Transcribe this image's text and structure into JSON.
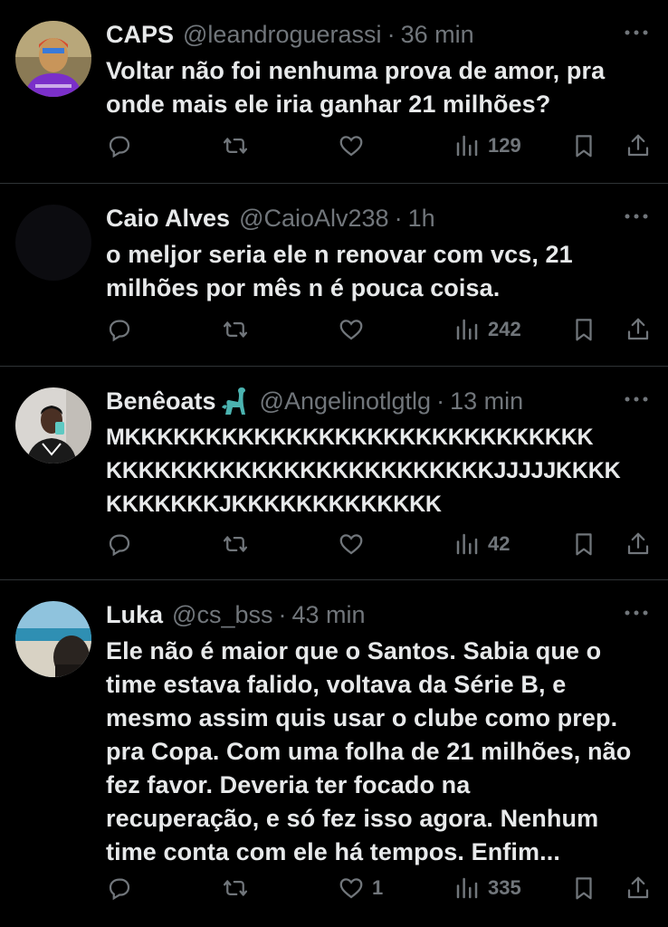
{
  "colors": {
    "background": "#000000",
    "text": "#e7e9ea",
    "secondary": "#71767b",
    "divider": "#2f3336"
  },
  "tweets": [
    {
      "name": "CAPS",
      "handle": "@leandroguerassi",
      "separator": "·",
      "time": "36 min",
      "text": "Voltar não foi nenhuma prova de amor, pra\nonde mais ele iria ganhar 21 milhões?",
      "replies": "",
      "retweets": "",
      "likes": "",
      "views": "129",
      "avatar_icon": "avatar-photo"
    },
    {
      "name": "Caio Alves",
      "handle": "@CaioAlv238",
      "separator": "·",
      "time": "1h",
      "text": "o meljor seria ele n renovar com vcs, 21\nmilhões por mês n é pouca coisa.",
      "replies": "",
      "retweets": "",
      "likes": "",
      "views": "242",
      "avatar_icon": "avatar-dark"
    },
    {
      "name": "Benêoats",
      "name_emoji": "dinosaur-emoji",
      "handle": "@Angelinotlgtlg",
      "separator": "·",
      "time": "13 min",
      "text": "MKKKKKKKKKKKKKKKKKKKKKKKKKKKKK\nKKKKKKKKKKKKKKKKKKKKKKKKJJJJJKKKK\nKKKKKKKJKKKKKKKKKKKKK",
      "replies": "",
      "retweets": "",
      "likes": "",
      "views": "42",
      "avatar_icon": "avatar-photo"
    },
    {
      "name": "Luka",
      "handle": "@cs_bss",
      "separator": "·",
      "time": "43 min",
      "text": "Ele não é maior que o Santos. Sabia que o\ntime estava falido, voltava da Série B, e\nmesmo assim quis usar o clube como prep.\npra Copa. Com uma folha de 21 milhões, não\nfez favor. Deveria ter focado na\nrecuperação, e só fez isso agora. Nenhum\ntime conta com ele há tempos. Enfim...",
      "replies": "",
      "retweets": "",
      "likes": "1",
      "views": "335",
      "avatar_icon": "avatar-beach-photo"
    }
  ]
}
